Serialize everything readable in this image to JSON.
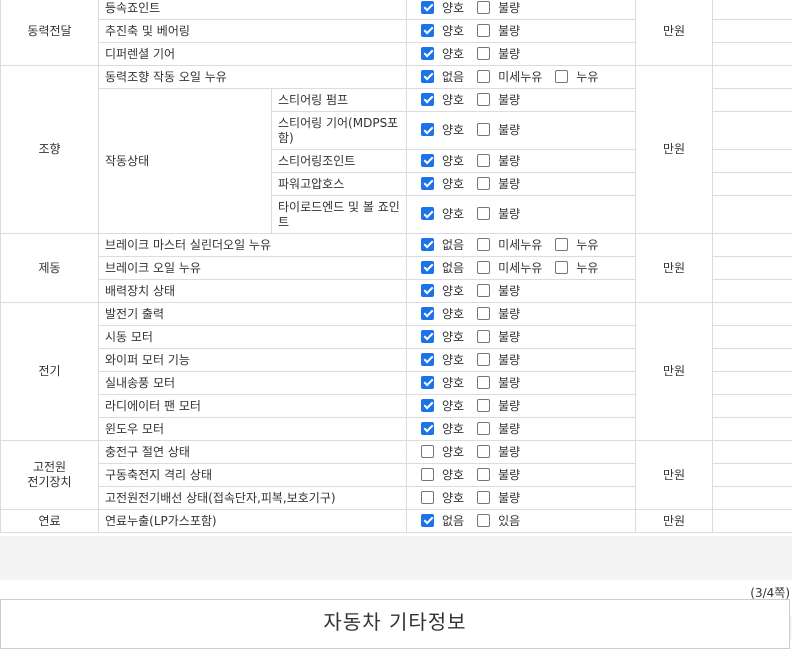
{
  "sections": [
    {
      "category": "동력전달",
      "cost": "만원",
      "rows": [
        {
          "item": "등속죠인트",
          "options": [
            {
              "label": "양호",
              "checked": true
            },
            {
              "label": "불량",
              "checked": false
            }
          ]
        },
        {
          "item": "추진축 및 베어링",
          "options": [
            {
              "label": "양호",
              "checked": true
            },
            {
              "label": "불량",
              "checked": false
            }
          ]
        },
        {
          "item": "디퍼렌셜 기어",
          "options": [
            {
              "label": "양호",
              "checked": true
            },
            {
              "label": "불량",
              "checked": false
            }
          ]
        }
      ]
    },
    {
      "category": "조향",
      "cost": "만원",
      "rows": [
        {
          "item": "동력조향 작동 오일 누유",
          "options": [
            {
              "label": "없음",
              "checked": true
            },
            {
              "label": "미세누유",
              "checked": false
            },
            {
              "label": "누유",
              "checked": false
            }
          ]
        },
        {
          "item": "작동상태",
          "sub": "스티어링 펌프",
          "options": [
            {
              "label": "양호",
              "checked": true
            },
            {
              "label": "불량",
              "checked": false
            }
          ]
        },
        {
          "sub": "스티어링 기어(MDPS포함)",
          "options": [
            {
              "label": "양호",
              "checked": true
            },
            {
              "label": "불량",
              "checked": false
            }
          ]
        },
        {
          "sub": "스티어링조인트",
          "options": [
            {
              "label": "양호",
              "checked": true
            },
            {
              "label": "불량",
              "checked": false
            }
          ]
        },
        {
          "sub": "파워고압호스",
          "options": [
            {
              "label": "양호",
              "checked": true
            },
            {
              "label": "불량",
              "checked": false
            }
          ]
        },
        {
          "sub": "타이로드엔드 및 볼 죠인트",
          "options": [
            {
              "label": "양호",
              "checked": true
            },
            {
              "label": "불량",
              "checked": false
            }
          ]
        }
      ]
    },
    {
      "category": "제동",
      "cost": "만원",
      "rows": [
        {
          "item": "브레이크 마스터 실린더오일 누유",
          "options": [
            {
              "label": "없음",
              "checked": true
            },
            {
              "label": "미세누유",
              "checked": false
            },
            {
              "label": "누유",
              "checked": false
            }
          ]
        },
        {
          "item": "브레이크 오일 누유",
          "options": [
            {
              "label": "없음",
              "checked": true
            },
            {
              "label": "미세누유",
              "checked": false
            },
            {
              "label": "누유",
              "checked": false
            }
          ]
        },
        {
          "item": "배력장치 상태",
          "options": [
            {
              "label": "양호",
              "checked": true
            },
            {
              "label": "불량",
              "checked": false
            }
          ]
        }
      ]
    },
    {
      "category": "전기",
      "cost": "만원",
      "rows": [
        {
          "item": "발전기 출력",
          "options": [
            {
              "label": "양호",
              "checked": true
            },
            {
              "label": "불량",
              "checked": false
            }
          ]
        },
        {
          "item": "시동 모터",
          "options": [
            {
              "label": "양호",
              "checked": true
            },
            {
              "label": "불량",
              "checked": false
            }
          ]
        },
        {
          "item": "와이퍼 모터 기능",
          "options": [
            {
              "label": "양호",
              "checked": true
            },
            {
              "label": "불량",
              "checked": false
            }
          ]
        },
        {
          "item": "실내송풍 모터",
          "options": [
            {
              "label": "양호",
              "checked": true
            },
            {
              "label": "불량",
              "checked": false
            }
          ]
        },
        {
          "item": "라디에이터 팬 모터",
          "options": [
            {
              "label": "양호",
              "checked": true
            },
            {
              "label": "불량",
              "checked": false
            }
          ]
        },
        {
          "item": "윈도우 모터",
          "options": [
            {
              "label": "양호",
              "checked": true
            },
            {
              "label": "불량",
              "checked": false
            }
          ]
        }
      ]
    },
    {
      "category": "고전원 전기장치",
      "cost": "만원",
      "rows": [
        {
          "item": "충전구 절연 상태",
          "options": [
            {
              "label": "양호",
              "checked": false
            },
            {
              "label": "불량",
              "checked": false
            }
          ]
        },
        {
          "item": "구동축전지 격리 상태",
          "options": [
            {
              "label": "양호",
              "checked": false
            },
            {
              "label": "불량",
              "checked": false
            }
          ]
        },
        {
          "item": "고전원전기배선 상태(접속단자,피복,보호기구)",
          "options": [
            {
              "label": "양호",
              "checked": false
            },
            {
              "label": "불량",
              "checked": false
            }
          ]
        }
      ]
    },
    {
      "category": "연료",
      "cost": "만원",
      "rows": [
        {
          "item": "연료누출(LP가스포함)",
          "options": [
            {
              "label": "없음",
              "checked": true
            },
            {
              "label": "있음",
              "checked": false
            }
          ]
        }
      ]
    }
  ],
  "page_number": "(3/4쪽)",
  "next_section_title": "자동차 기타정보"
}
